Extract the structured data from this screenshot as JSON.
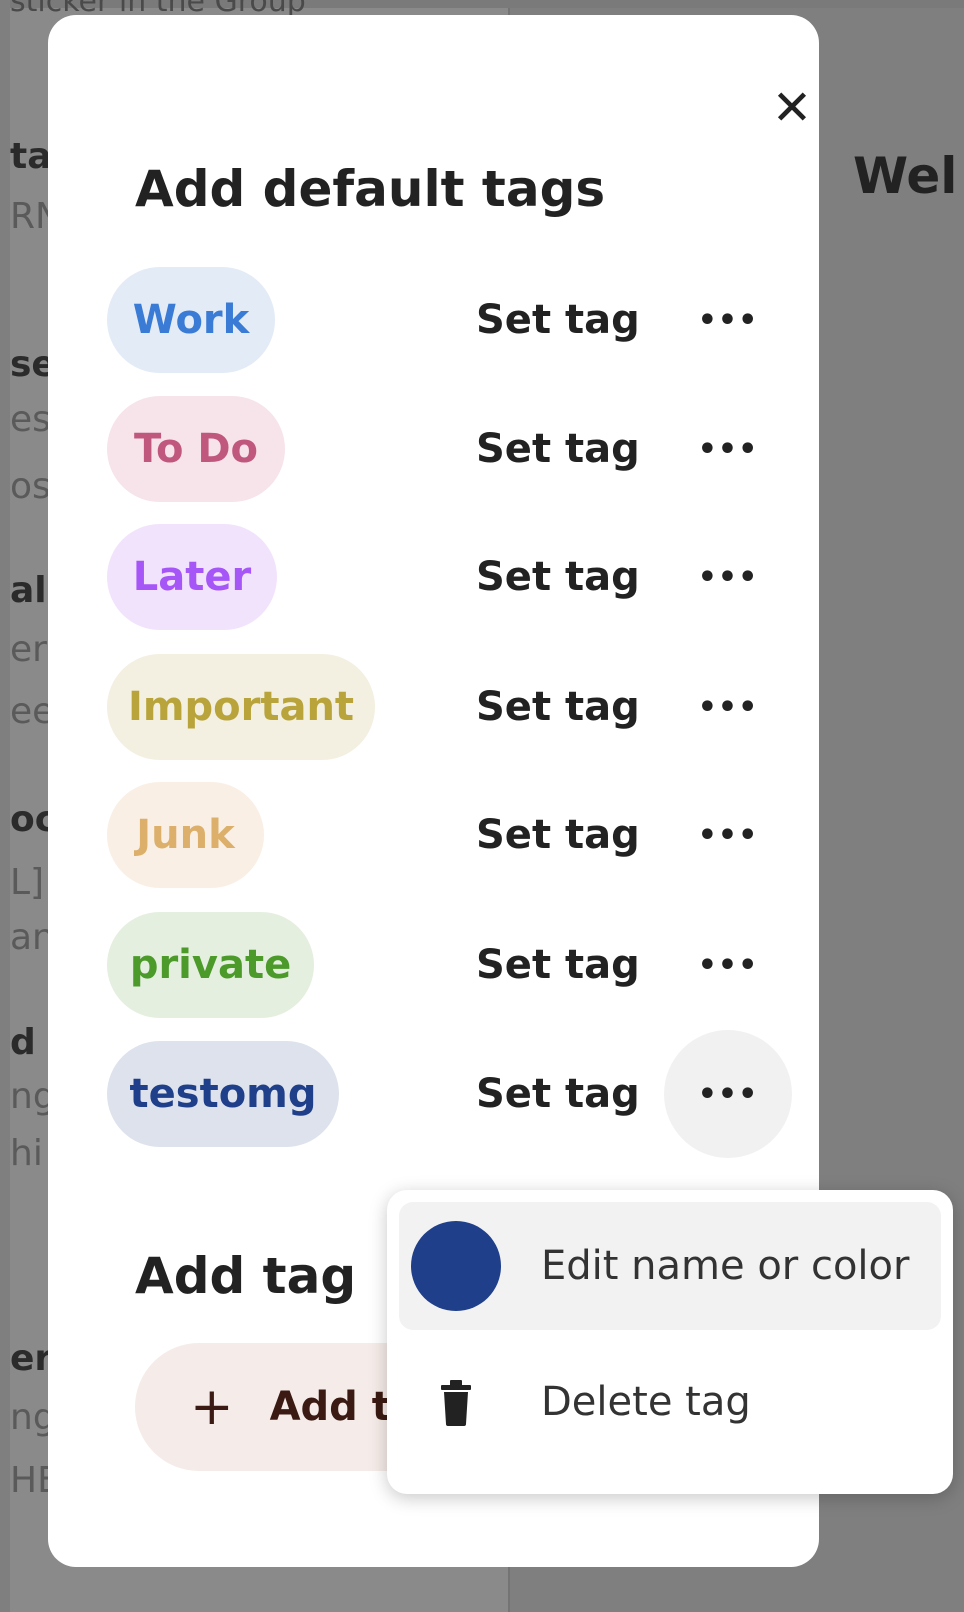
{
  "background": {
    "top_fragment": "sticker in the Group",
    "welcome_fragment": "Wel",
    "left_fragments": [
      "ta",
      "RN",
      "se",
      "es",
      "os",
      "al",
      "er",
      "ee",
      "oc",
      "L]",
      "an",
      "d S",
      "ng",
      "hi",
      "er:",
      "ng",
      "HE"
    ]
  },
  "modal": {
    "title": "Add default tags",
    "close_glyph": "✕",
    "tags": [
      {
        "name": "Work",
        "text_color": "#3a7bd5",
        "bg_color": "#e2ebf6"
      },
      {
        "name": "To Do",
        "text_color": "#c0587e",
        "bg_color": "#f7e3ea"
      },
      {
        "name": "Later",
        "text_color": "#a655f7",
        "bg_color": "#f1e3fc"
      },
      {
        "name": "Important",
        "text_color": "#b8a43a",
        "bg_color": "#f3efe1"
      },
      {
        "name": "Junk",
        "text_color": "#dcb06a",
        "bg_color": "#f9efe5"
      },
      {
        "name": "private",
        "text_color": "#4c9a2a",
        "bg_color": "#e4efdf"
      },
      {
        "name": "testomg",
        "text_color": "#1f3f8a",
        "bg_color": "#dde2ec"
      }
    ],
    "set_tag_label": "Set tag",
    "more_glyph": "•••",
    "add_tag_title": "Add tag",
    "add_tag_button": {
      "icon": "+",
      "label": "Add tag"
    }
  },
  "popover": {
    "edit_label": "Edit name or color",
    "edit_swatch_color": "#1f3f8a",
    "delete_label": "Delete tag",
    "delete_icon": "trash-icon"
  }
}
